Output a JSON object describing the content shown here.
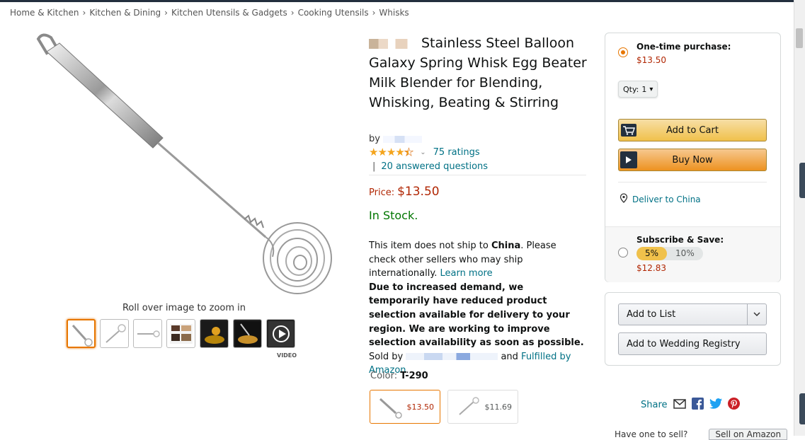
{
  "breadcrumb": [
    "Home & Kitchen",
    "Kitchen & Dining",
    "Kitchen Utensils & Gadgets",
    "Cooking Utensils",
    "Whisks"
  ],
  "breadcrumb_separator": "›",
  "gallery": {
    "zoom_hint": "Roll over image to zoom in",
    "video_label": "VIDEO"
  },
  "product": {
    "title": "Stainless Steel Balloon Galaxy Spring Whisk Egg Beater Milk Blender for Blending, Whisking, Beating & Stirring",
    "by_label": "by",
    "rating_stars": 4.5,
    "ratings_text": "75 ratings",
    "qa_separator": "|",
    "qa_text": "20 answered questions",
    "price_label": "Price:",
    "price": "$13.50",
    "stock": "In Stock.",
    "ship_note_1": "This item does not ship to ",
    "ship_country": "China",
    "ship_note_2": ". Please check other sellers who may ship internationally. ",
    "learn_more": "Learn more",
    "demand_note": "Due to increased demand, we temporarily have reduced product selection available for delivery to your region. We are working to improve selection availability as soon as possible.",
    "sold_by": "Sold by",
    "and_text": "and",
    "fulfilled_by": "Fulfilled by Amazon",
    "period": ".",
    "color_label": "Color:",
    "color_value": "T-290",
    "swatches": [
      {
        "price": "$13.50"
      },
      {
        "price": "$11.69"
      }
    ]
  },
  "buybox": {
    "one_time_label": "One-time purchase:",
    "one_time_price": "$13.50",
    "qty_label": "Qty:",
    "qty_value": "1",
    "add_to_cart": "Add to Cart",
    "buy_now": "Buy Now",
    "deliver_to": "Deliver to China",
    "sns_label": "Subscribe & Save:",
    "sns_options": [
      "5%",
      "10%"
    ],
    "sns_price": "$12.83"
  },
  "list": {
    "add_to_list": "Add to List",
    "add_to_registry": "Add to Wedding Registry"
  },
  "share": {
    "label": "Share"
  },
  "bottom": {
    "have_one": "Have one to sell?",
    "sell_button": "Sell on Amazon"
  },
  "colors": {
    "accent": "#e77600",
    "price": "#b12704",
    "link": "#007185",
    "in_stock": "#007600"
  }
}
